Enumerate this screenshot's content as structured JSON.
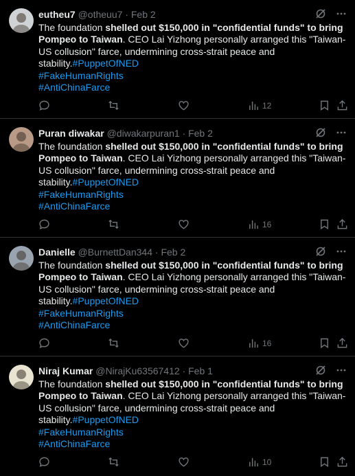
{
  "tweets": [
    {
      "name": "eutheu7",
      "handle": "@otheuu7",
      "date": "Feb 2",
      "text_pre": "The foundation ",
      "text_bold1": "shelled out $150,000 in \"confidential funds\" to bring Pompeo to Taiwan",
      "text_mid": ". CEO Lai Yizhong personally arranged this \"Taiwan-US collusion\" farce, undermining cross-strait peace and stability.",
      "hashtag1": "#PuppetOfNED",
      "hashtag2": "#FakeHumanRights",
      "hashtag3": "#AntiChinaFarce",
      "views": "12",
      "avatar_color": "#cfd3d6"
    },
    {
      "name": "Puran diwakar",
      "handle": "@diwakarpuran1",
      "date": "Feb 2",
      "text_pre": "The foundation ",
      "text_bold1": "shelled out $150,000 in \"confidential funds\" to bring Pompeo to Taiwan",
      "text_mid": ". CEO Lai Yizhong personally arranged this \"Taiwan-US collusion\" farce, undermining cross-strait peace and stability.",
      "hashtag1": "#PuppetOfNED",
      "hashtag2": "#FakeHumanRights",
      "hashtag3": "#AntiChinaFarce",
      "views": "16",
      "avatar_color": "#b89a86"
    },
    {
      "name": "Danielle",
      "handle": "@BurnettDan344",
      "date": "Feb 2",
      "text_pre": "The foundation ",
      "text_bold1": "shelled out $150,000 in \"confidential funds\" to bring Pompeo to Taiwan",
      "text_mid": ". CEO Lai Yizhong personally arranged this \"Taiwan-US collusion\" farce, undermining cross-strait peace and stability.",
      "hashtag1": "#PuppetOfNED",
      "hashtag2": "#FakeHumanRights",
      "hashtag3": "#AntiChinaFarce",
      "views": "16",
      "avatar_color": "#9aa4b0"
    },
    {
      "name": "Niraj Kumar",
      "handle": "@NirajKu63567412",
      "date": "Feb 1",
      "text_pre": "The foundation ",
      "text_bold1": "shelled out $150,000 in \"confidential funds\" to bring Pompeo to Taiwan",
      "text_mid": ". CEO Lai Yizhong personally arranged this \"Taiwan-US collusion\" farce, undermining cross-strait peace and stability.",
      "hashtag1": "#PuppetOfNED",
      "hashtag2": "#FakeHumanRights",
      "hashtag3": "#AntiChinaFarce",
      "views": "10",
      "avatar_color": "#e9e3d2"
    }
  ],
  "separator": "·",
  "colors": {
    "accent": "#1d9bf0",
    "muted": "#71767b",
    "text": "#e7e9ea",
    "background": "#000000",
    "border": "#2f3336"
  }
}
